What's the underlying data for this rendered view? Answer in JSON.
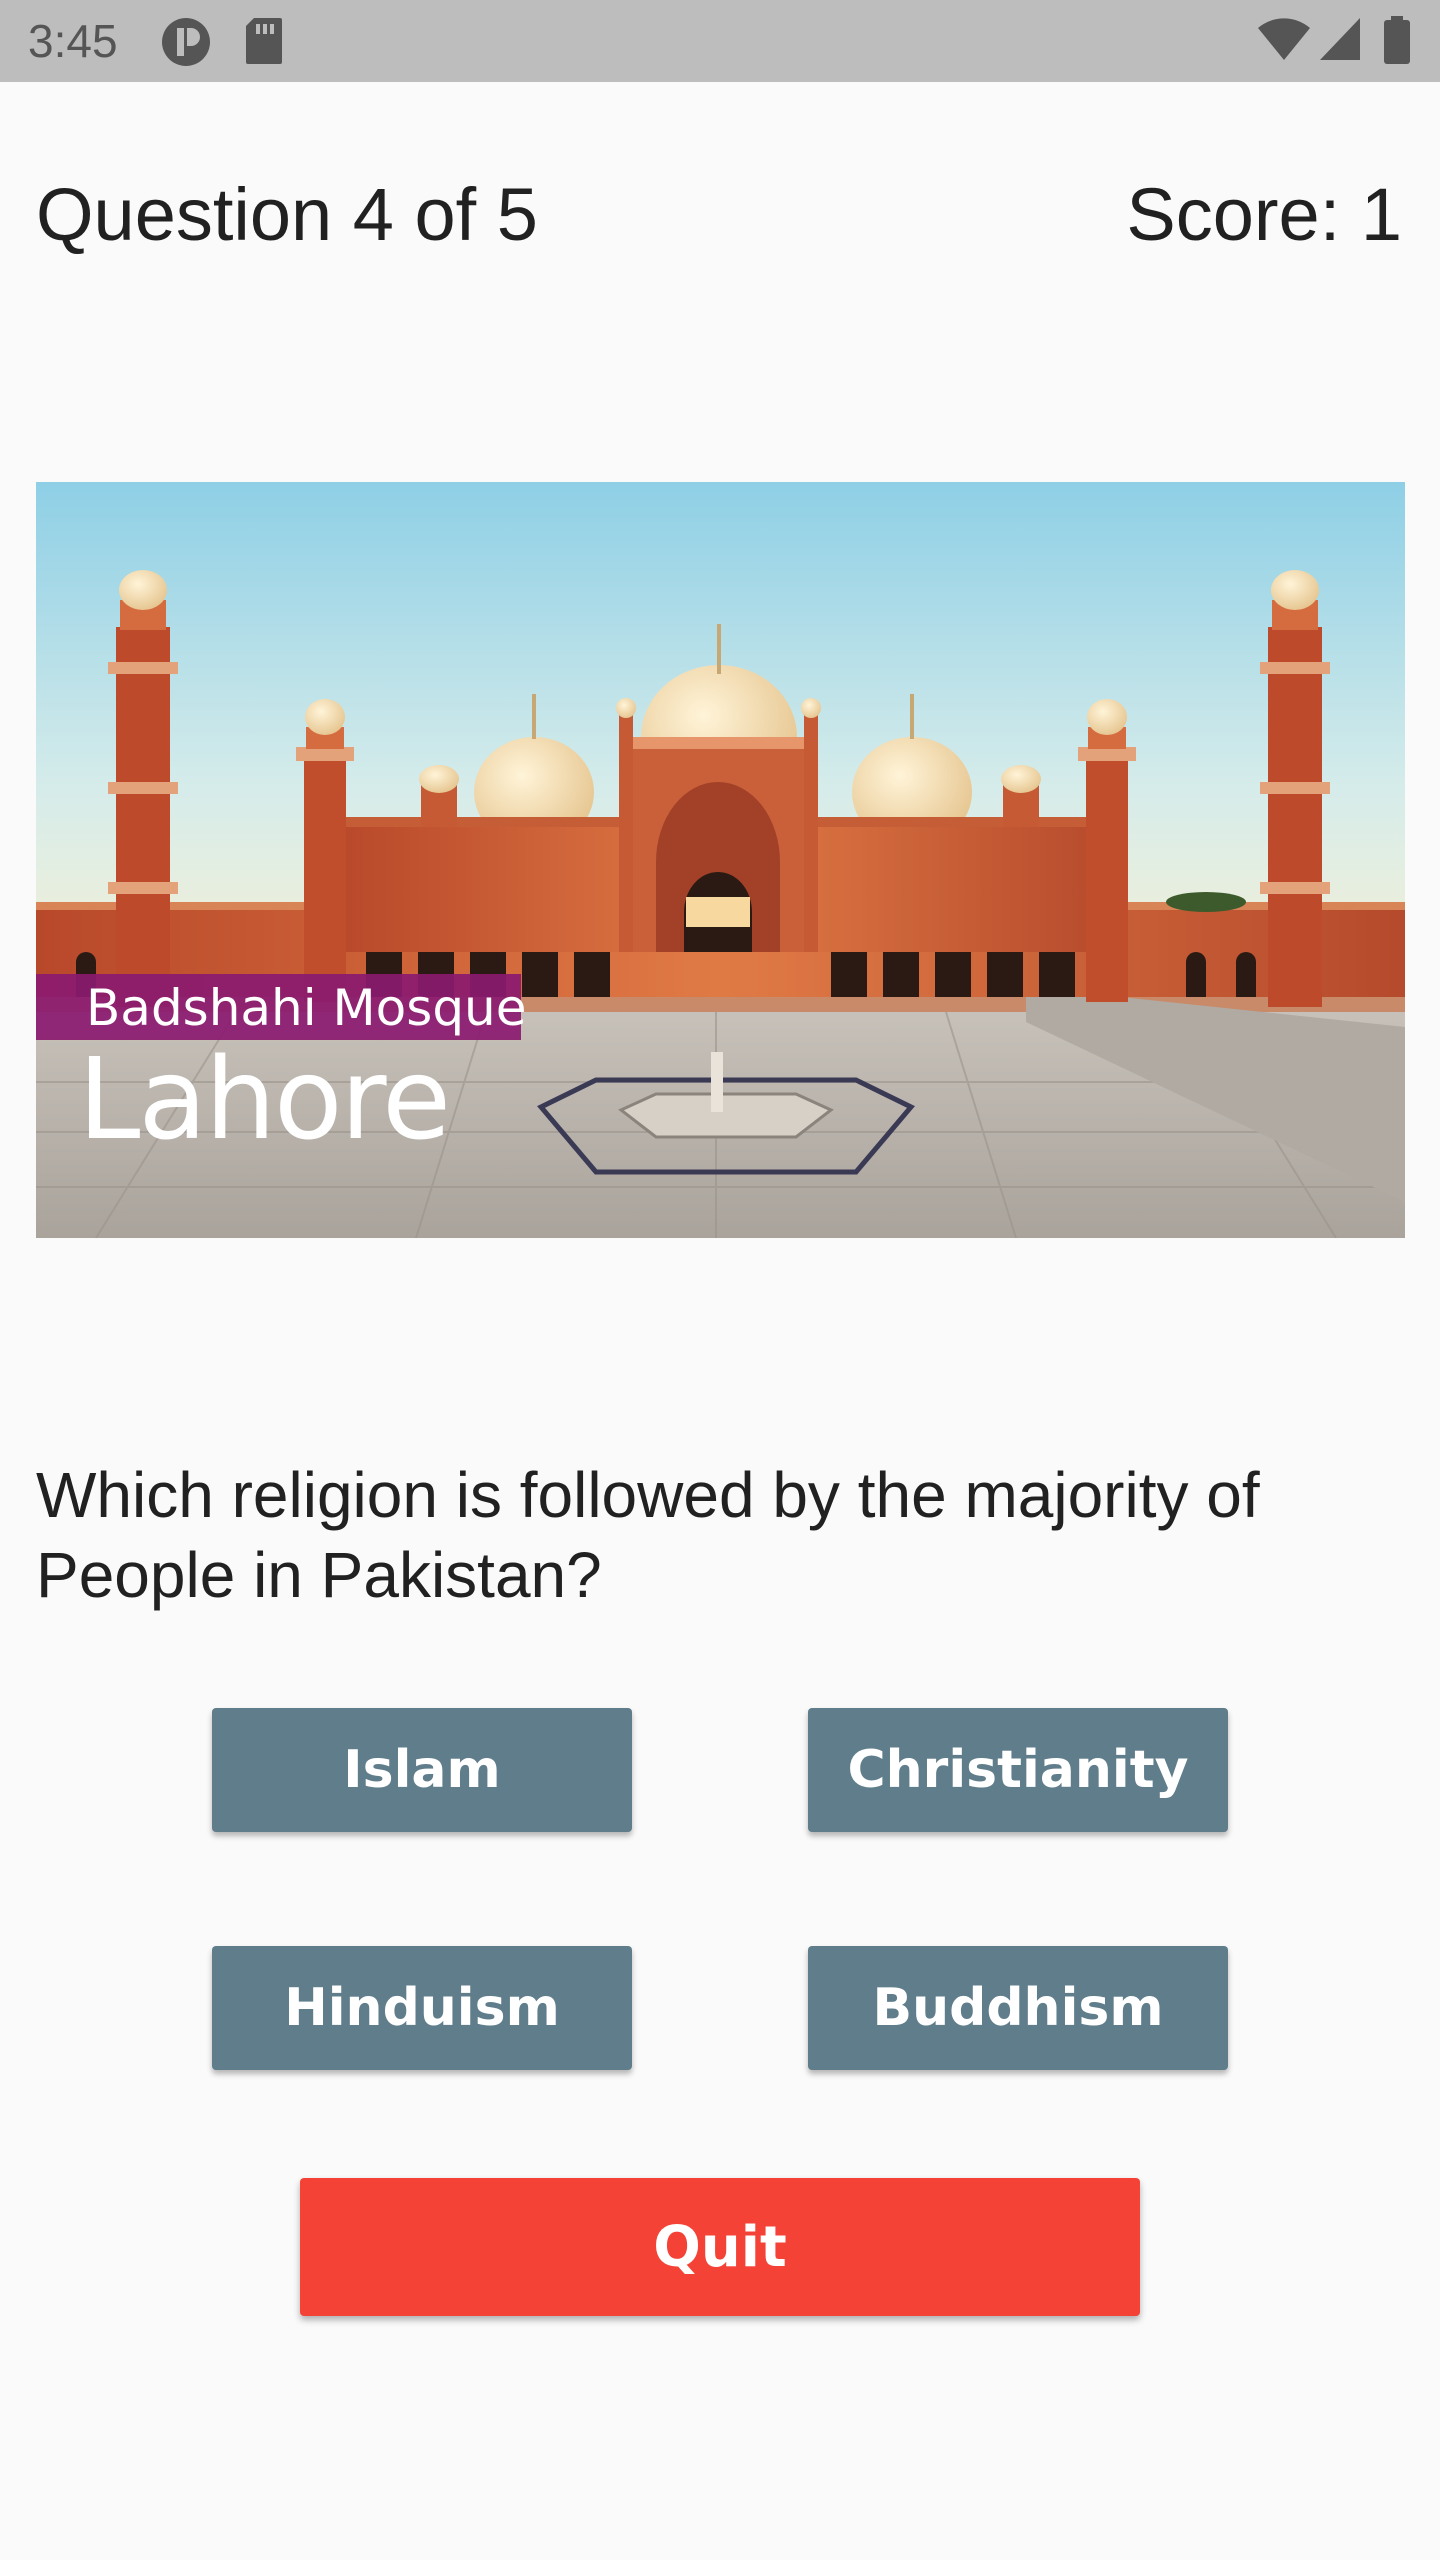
{
  "status_bar": {
    "time": "3:45",
    "left_icons": [
      "p-icon",
      "sd-card-icon"
    ],
    "right_icons": [
      "wifi-icon",
      "cell-signal-icon",
      "battery-icon"
    ]
  },
  "header": {
    "question_counter": "Question 4 of 5",
    "score": "Score: 1"
  },
  "image": {
    "caption_small": "Badshahi Mosque",
    "caption_large": "Lahore"
  },
  "question": {
    "text": "Which religion is followed by the majority of People in Pakistan?"
  },
  "answers": [
    {
      "label": "Islam"
    },
    {
      "label": "Christianity"
    },
    {
      "label": "Hinduism"
    },
    {
      "label": "Buddhism"
    }
  ],
  "quit_label": "Quit",
  "colors": {
    "answer_button": "#607d8b",
    "quit_button": "#f44336",
    "status_bar": "#bdbdbd",
    "background": "#fafafa"
  }
}
